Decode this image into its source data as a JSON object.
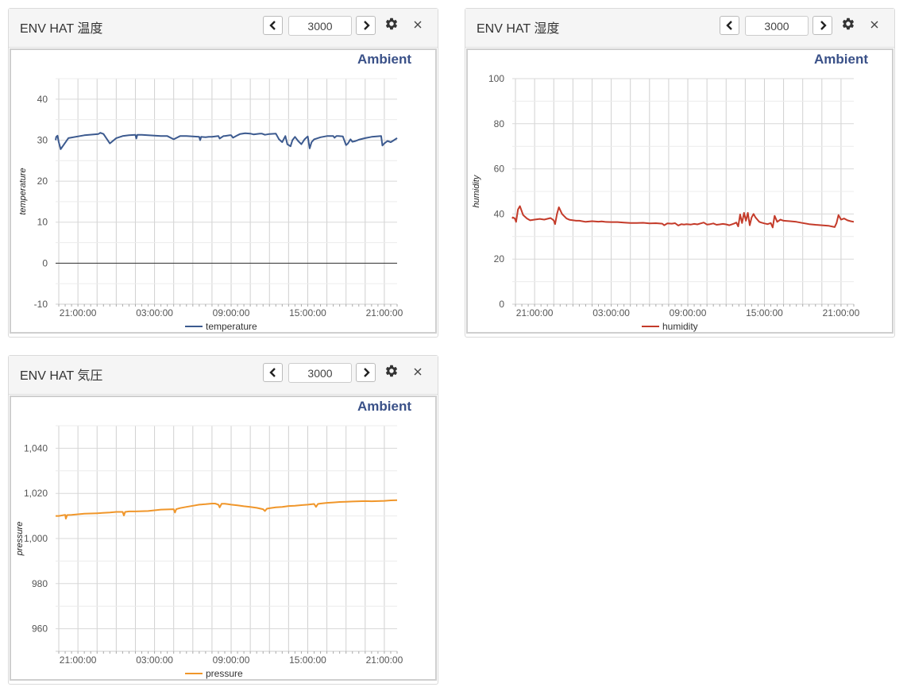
{
  "panels": [
    {
      "title": "ENV HAT 温度",
      "count": "3000",
      "brand": "Ambient",
      "ytitle": "temperature",
      "legend": "temperature"
    },
    {
      "title": "ENV HAT 湿度",
      "count": "3000",
      "brand": "Ambient",
      "ytitle": "humidity",
      "legend": "humidity"
    },
    {
      "title": "ENV HAT 気圧",
      "count": "3000",
      "brand": "Ambient",
      "ytitle": "pressure",
      "legend": "pressure"
    }
  ],
  "icons": {
    "prev": "chevron-left-icon",
    "next": "chevron-right-icon",
    "settings": "gear-icon",
    "close": "close-icon"
  },
  "chart_data": [
    {
      "type": "line",
      "ylabel": "temperature",
      "ylim": [
        -10,
        45
      ],
      "yticks": [
        -10,
        0,
        10,
        20,
        30,
        40
      ],
      "xticks": [
        "21:00:00",
        "03:00:00",
        "09:00:00",
        "15:00:00",
        "21:00:00"
      ],
      "zero_line": true,
      "grid": true,
      "legend_position": "bottom",
      "series": [
        {
          "name": "temperature",
          "color": "#3c5a8f",
          "x": [
            17.5,
            17.6,
            17.8,
            18.0,
            18.3,
            19.5,
            22.0,
            24.2,
            24.5,
            25.0,
            26.0,
            27.0,
            28.0,
            29.0,
            30.0,
            30.15,
            30.3,
            31.0,
            32.0,
            33.0,
            34.0,
            35.0,
            36.0,
            37.0,
            38.0,
            39.0,
            40.0,
            40.15,
            40.3,
            41.0,
            41.5,
            42.0,
            43.0,
            43.2,
            43.8,
            44.0,
            44.4,
            44.8,
            45.0,
            45.3,
            46.0,
            46.4,
            46.8,
            47.2,
            48.0,
            48.5,
            49.0,
            49.5,
            49.8,
            50.3,
            51.0,
            52.0,
            52.5,
            53.0,
            53.5,
            53.8,
            54.3,
            54.6,
            55.0,
            55.5,
            56.0,
            56.5,
            57.0,
            57.3,
            57.6,
            58.0,
            59.0,
            60.0,
            61.0,
            61.2,
            61.5,
            61.8,
            62.5,
            63.0,
            63.3,
            63.7,
            64.0,
            64.5,
            65.0,
            66.0,
            67.0,
            68.5,
            68.7,
            69.0,
            69.5,
            70.0,
            70.5,
            71.0
          ],
          "y": [
            30,
            30.8,
            31.1,
            29.5,
            27.8,
            30.5,
            31.2,
            31.5,
            31.8,
            31.5,
            29.2,
            30.5,
            31.0,
            31.2,
            31.3,
            30.4,
            31.3,
            31.3,
            31.2,
            31.1,
            31.0,
            31.0,
            30.2,
            31.0,
            31.0,
            30.9,
            30.8,
            30.0,
            30.8,
            30.7,
            30.8,
            30.8,
            31.0,
            30.4,
            31.0,
            31.0,
            31.1,
            31.2,
            31.2,
            30.6,
            31.2,
            31.5,
            31.6,
            31.7,
            31.6,
            31.4,
            31.5,
            31.6,
            31.6,
            31.3,
            31.5,
            31.6,
            30.2,
            29.5,
            31.0,
            29.0,
            28.5,
            30.0,
            30.8,
            29.8,
            29.0,
            30.2,
            30.9,
            28.0,
            29.5,
            30.2,
            30.7,
            31.0,
            31.0,
            30.6,
            31.0,
            31.0,
            30.9,
            28.8,
            29.2,
            30.2,
            29.6,
            29.8,
            30.1,
            30.5,
            30.8,
            31.0,
            28.7,
            29.2,
            29.8,
            29.5,
            30.0,
            30.5
          ]
        }
      ]
    },
    {
      "type": "line",
      "ylabel": "humidity",
      "ylim": [
        0,
        100
      ],
      "yticks": [
        0,
        20,
        40,
        60,
        80,
        100
      ],
      "xticks": [
        "21:00:00",
        "03:00:00",
        "09:00:00",
        "15:00:00",
        "21:00:00"
      ],
      "grid": true,
      "legend_position": "bottom",
      "series": [
        {
          "name": "humidity",
          "color": "#c43b2a",
          "x": [
            17.5,
            17.6,
            17.9,
            18.1,
            18.4,
            18.7,
            19.2,
            19.8,
            20.3,
            21.0,
            21.8,
            22.5,
            23.5,
            24.0,
            24.2,
            24.5,
            24.8,
            25.3,
            26.0,
            26.5,
            27.5,
            28.0,
            29.0,
            30.0,
            31.0,
            31.5,
            32.0,
            33.0,
            34.0,
            35.0,
            36.0,
            37.0,
            38.0,
            39.0,
            40.0,
            41.0,
            41.3,
            41.8,
            42.5,
            43.0,
            43.5,
            44.0,
            44.4,
            44.8,
            45.5,
            46.0,
            46.5,
            47.0,
            47.5,
            48.0,
            48.5,
            49.0,
            49.5,
            50.0,
            50.5,
            51.0,
            51.5,
            52.0,
            52.3,
            52.6,
            52.9,
            53.2,
            53.5,
            53.8,
            54.1,
            54.4,
            54.7,
            55.0,
            55.3,
            55.6,
            55.9,
            56.2,
            56.5,
            57.0,
            57.5,
            58.0,
            58.3,
            58.6,
            59.0,
            59.5,
            60.0,
            61.0,
            62.0,
            63.0,
            64.0,
            65.0,
            66.0,
            67.0,
            68.0,
            68.3,
            68.6,
            69.0,
            69.5,
            70.0,
            70.5,
            71.0
          ],
          "y": [
            38,
            38.5,
            38.0,
            36.5,
            42.0,
            43.5,
            39.5,
            38.0,
            37.2,
            37.5,
            37.8,
            37.5,
            38.2,
            37.2,
            35.5,
            40.0,
            43.0,
            40.0,
            38.0,
            37.4,
            37.0,
            37.0,
            36.5,
            36.8,
            36.6,
            36.7,
            36.5,
            36.4,
            36.4,
            36.2,
            36.0,
            36.0,
            36.1,
            35.8,
            35.9,
            35.7,
            35.0,
            35.8,
            35.7,
            35.9,
            34.9,
            35.5,
            35.3,
            35.5,
            35.3,
            35.6,
            35.4,
            35.8,
            36.2,
            35.3,
            35.5,
            35.8,
            35.2,
            35.4,
            35.6,
            35.4,
            35.0,
            35.5,
            35.8,
            36.2,
            34.5,
            39.8,
            36.0,
            40.5,
            37.0,
            40.5,
            35.0,
            38.5,
            40.0,
            38.5,
            37.5,
            36.5,
            36.2,
            35.8,
            35.5,
            36.0,
            34.0,
            39.2,
            36.5,
            37.5,
            37.0,
            36.8,
            36.5,
            36.0,
            35.5,
            35.2,
            35.0,
            34.8,
            34.2,
            36.0,
            39.5,
            37.5,
            38.0,
            37.2,
            36.8,
            36.5
          ]
        }
      ]
    },
    {
      "type": "line",
      "ylabel": "pressure",
      "ylim": [
        950,
        1050
      ],
      "yticks": [
        960,
        980,
        1000,
        1020,
        1040
      ],
      "xticks": [
        "21:00:00",
        "03:00:00",
        "09:00:00",
        "15:00:00",
        "21:00:00"
      ],
      "grid": true,
      "legend_position": "bottom",
      "series": [
        {
          "name": "pressure",
          "color": "#f0962a",
          "x": [
            17.5,
            18.0,
            19.0,
            19.1,
            19.3,
            20.0,
            22.0,
            24.0,
            26.0,
            27.0,
            28.0,
            28.2,
            28.4,
            29.0,
            30.0,
            32.0,
            34.0,
            36.0,
            36.2,
            36.4,
            37.0,
            38.0,
            39.0,
            40.0,
            41.0,
            42.0,
            42.5,
            43.0,
            43.2,
            43.5,
            44.0,
            44.5,
            45.0,
            46.0,
            47.0,
            48.0,
            49.0,
            50.0,
            50.3,
            50.6,
            51.0,
            52.0,
            53.0,
            54.0,
            55.0,
            56.0,
            57.0,
            58.0,
            58.3,
            58.6,
            59.0,
            60.0,
            61.0,
            62.0,
            63.0,
            64.0,
            65.0,
            66.0,
            67.0,
            68.0,
            69.0,
            70.0,
            71.0
          ],
          "y": [
            1010.0,
            1010.0,
            1010.5,
            1008.8,
            1010.4,
            1010.5,
            1011.0,
            1011.2,
            1011.5,
            1011.8,
            1011.8,
            1010.2,
            1011.8,
            1012.0,
            1012.0,
            1012.2,
            1012.8,
            1013.0,
            1011.5,
            1013.0,
            1013.5,
            1014.0,
            1014.5,
            1015.0,
            1015.2,
            1015.5,
            1015.5,
            1015.0,
            1013.8,
            1015.4,
            1015.4,
            1015.2,
            1015.0,
            1014.7,
            1014.3,
            1014.0,
            1013.6,
            1013.0,
            1012.2,
            1013.2,
            1013.4,
            1013.8,
            1014.0,
            1014.4,
            1014.5,
            1014.8,
            1015.0,
            1015.3,
            1014.0,
            1015.3,
            1015.5,
            1015.8,
            1016.0,
            1016.2,
            1016.3,
            1016.4,
            1016.5,
            1016.6,
            1016.5,
            1016.6,
            1016.7,
            1016.9,
            1017.0
          ]
        }
      ]
    }
  ]
}
